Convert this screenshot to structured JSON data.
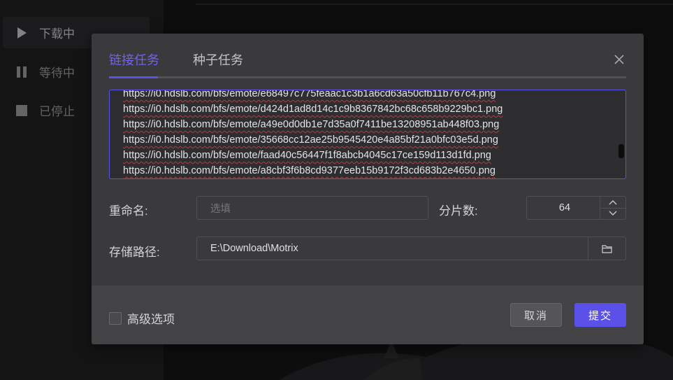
{
  "sidebar": {
    "items": [
      {
        "label": "下载中",
        "icon": "play-icon"
      },
      {
        "label": "等待中",
        "icon": "pause-icon"
      },
      {
        "label": "已停止",
        "icon": "stop-icon"
      }
    ]
  },
  "dialog": {
    "tabs": [
      {
        "label": "链接任务"
      },
      {
        "label": "种子任务"
      }
    ],
    "urls": [
      "https://i0.hdslb.com/bfs/emote/e68497c775feaac1c3b1a6cd63a50cfb11b767c4.png",
      "https://i0.hdslb.com/bfs/emote/d424d1ad8d14c1c9b8367842bc68c658b9229bc1.png",
      "https://i0.hdslb.com/bfs/emote/a49e0d0db1e7d35a0f7411be13208951ab448f03.png",
      "https://i0.hdslb.com/bfs/emote/35668cc12ae25b9545420e4a85bf21a0bfc03e5d.png",
      "https://i0.hdslb.com/bfs/emote/faad40c56447f1f8abcb4045c17ce159d113d1fd.png",
      "https://i0.hdslb.com/bfs/emote/a8cbf3f6b8cd9377eeb15b9172f3cd683b2e4650.png"
    ],
    "rename_label": "重命名:",
    "rename_placeholder": "选填",
    "shard_label": "分片数:",
    "shard_value": "64",
    "path_label": "存储路径:",
    "path_value": "E:\\Download\\Motrix",
    "advanced_label": "高级选项",
    "cancel_label": "取消",
    "submit_label": "提交"
  },
  "colors": {
    "accent": "#5b51e8",
    "dialog_bg": "#3a3a3c",
    "footer_bg": "#434345"
  }
}
